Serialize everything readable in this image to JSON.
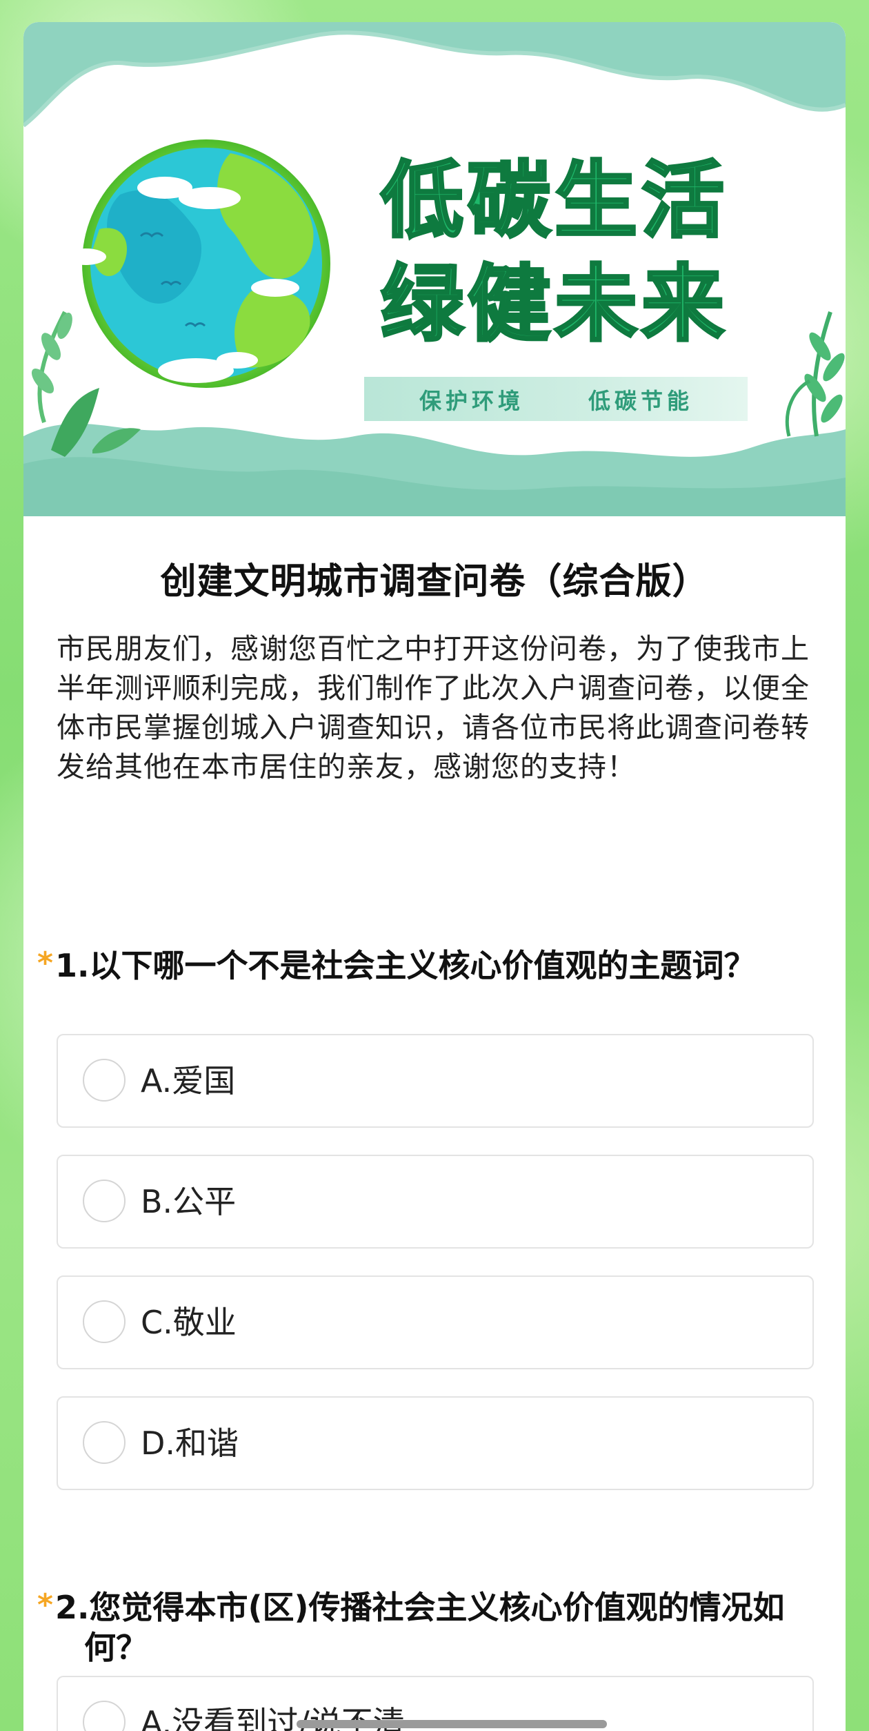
{
  "banner": {
    "headline_line1": "低碳生活",
    "headline_line2": "绿健未来",
    "tag_left": "保护环境",
    "tag_right": "低碳节能",
    "colors": {
      "headline": "#1fb86a",
      "headline_outline": "#0e7a3f",
      "wave": "#8fd3bf",
      "ocean": "#2cc7d6",
      "land": "#7fd943"
    }
  },
  "survey": {
    "title": "创建文明城市调查问卷（综合版）",
    "description": "市民朋友们，感谢您百忙之中打开这份问卷，为了使我市上半年测评顺利完成，我们制作了此次入户调查问卷，以便全体市民掌握创城入户调查知识，请各位市民将此调查问卷转发给其他在本市居住的亲友，感谢您的支持！"
  },
  "questions": [
    {
      "required_mark": "*",
      "text": "1.以下哪一个不是社会主义核心价值观的主题词？",
      "options": [
        "A.爱国",
        "B.公平",
        "C.敬业",
        "D.和谐"
      ]
    },
    {
      "required_mark": "*",
      "text": "2.您觉得本市(区)传播社会主义核心价值观的情况如何？",
      "options": [
        "A.没看到过/说不清"
      ]
    }
  ],
  "colors": {
    "required_star": "#f5a623",
    "background": "#8ee078"
  }
}
